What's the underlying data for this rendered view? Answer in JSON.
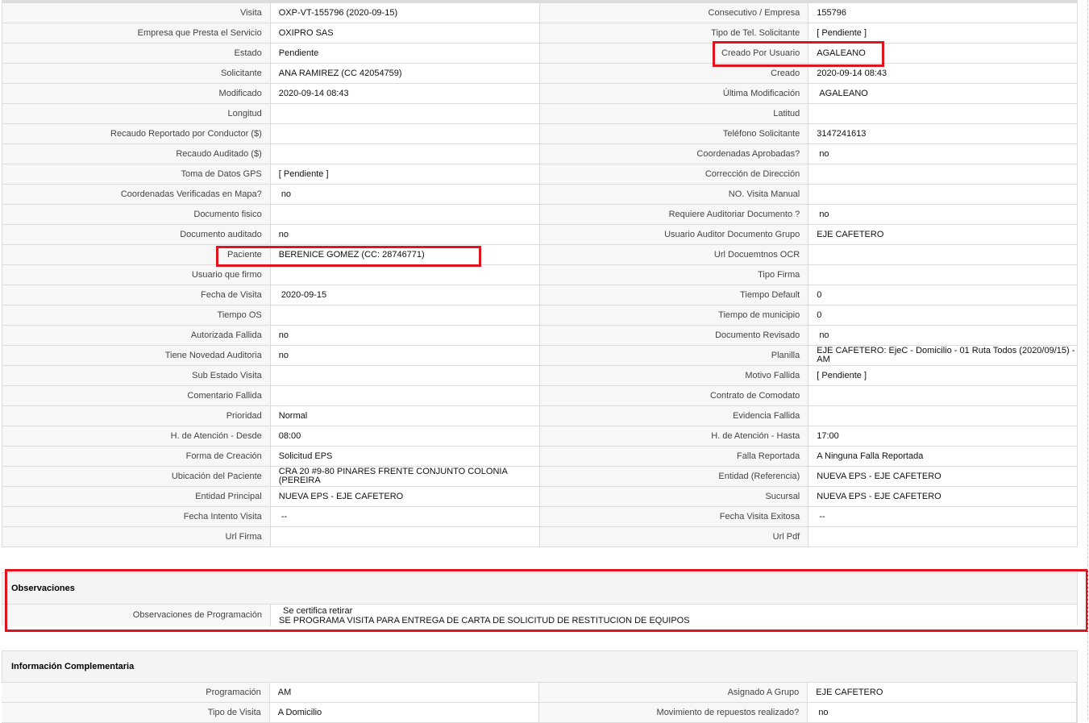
{
  "main_rows": [
    {
      "l1": "Visita",
      "v1": "OXP-VT-155796 (2020-09-15)",
      "l2": "Consecutivo / Empresa",
      "v2": "155796"
    },
    {
      "l1": "Empresa que Presta el Servicio",
      "v1": "OXIPRO SAS",
      "l2": "Tipo de Tel. Solicitante",
      "v2": "[ Pendiente ]"
    },
    {
      "l1": "Estado",
      "v1": "Pendiente",
      "l2": "Creado Por Usuario",
      "v2": "AGALEANO"
    },
    {
      "l1": "Solicitante",
      "v1": "ANA RAMIREZ (CC 42054759)",
      "l2": "Creado",
      "v2": "2020-09-14 08:43"
    },
    {
      "l1": "Modificado",
      "v1": "2020-09-14 08:43",
      "l2": "Última Modificación",
      "v2": " AGALEANO"
    },
    {
      "l1": "Longitud",
      "v1": "",
      "l2": "Latitud",
      "v2": ""
    },
    {
      "l1": "Recaudo Reportado por Conductor ($)",
      "v1": "",
      "l2": "Teléfono Solicitante",
      "v2": "3147241613"
    },
    {
      "l1": "Recaudo Auditado ($)",
      "v1": "",
      "l2": "Coordenadas Aprobadas?",
      "v2": " no"
    },
    {
      "l1": "Toma de Datos GPS",
      "v1": "[ Pendiente ]",
      "l2": "Corrección de Dirección",
      "v2": ""
    },
    {
      "l1": "Coordenadas Verificadas en Mapa?",
      "v1": " no",
      "l2": "NO. Visita Manual",
      "v2": ""
    },
    {
      "l1": "Documento fisico",
      "v1": "",
      "l2": "Requiere Auditoriar Documento ?",
      "v2": " no"
    },
    {
      "l1": "Documento auditado",
      "v1": "no",
      "l2": "Usuario Auditor Documento Grupo",
      "v2": "EJE CAFETERO"
    },
    {
      "l1": "Paciente",
      "v1": "BERENICE GOMEZ (CC: 28746771)",
      "l2": "Url Docuemtnos OCR",
      "v2": ""
    },
    {
      "l1": "Usuario que firmo",
      "v1": "",
      "l2": "Tipo Firma",
      "v2": ""
    },
    {
      "l1": "Fecha de Visita",
      "v1": " 2020-09-15",
      "l2": "Tiempo Default",
      "v2": "0"
    },
    {
      "l1": "Tiempo OS",
      "v1": "",
      "l2": "Tiempo de municipio",
      "v2": "0"
    },
    {
      "l1": "Autorizada Fallida",
      "v1": "no",
      "l2": "Documento Revisado",
      "v2": " no"
    },
    {
      "l1": "Tiene Novedad Auditoria",
      "v1": "no",
      "l2": "Planilla",
      "v2": "EJE CAFETERO: EjeC - Domicilio - 01 Ruta Todos (2020/09/15) - AM"
    },
    {
      "l1": "Sub Estado Visita",
      "v1": "",
      "l2": "Motivo Fallida",
      "v2": "[ Pendiente ]"
    },
    {
      "l1": "Comentario Fallida",
      "v1": "",
      "l2": "Contrato de Comodato",
      "v2": ""
    },
    {
      "l1": "Prioridad",
      "v1": "Normal",
      "l2": "Evidencia Fallida",
      "v2": ""
    },
    {
      "l1": "H. de Atención - Desde",
      "v1": "08:00",
      "l2": "H. de Atención - Hasta",
      "v2": "17:00"
    },
    {
      "l1": "Forma de Creación",
      "v1": "Solicitud EPS",
      "l2": "Falla Reportada",
      "v2": "A Ninguna Falla Reportada"
    },
    {
      "l1": "Ubicación del Paciente",
      "v1": "CRA 20 #9-80 PINARES FRENTE CONJUNTO COLONIA (PEREIRA",
      "l2": "Entidad (Referencia)",
      "v2": "NUEVA EPS - EJE CAFETERO"
    },
    {
      "l1": "Entidad Principal",
      "v1": "NUEVA EPS - EJE CAFETERO",
      "l2": "Sucursal",
      "v2": "NUEVA EPS - EJE CAFETERO"
    },
    {
      "l1": "Fecha Intento Visita",
      "v1": " --",
      "l2": "Fecha Visita Exitosa",
      "v2": " --"
    },
    {
      "l1": "Url Firma",
      "v1": "",
      "l2": "Url Pdf",
      "v2": ""
    }
  ],
  "observaciones": {
    "title": "Observaciones",
    "label": "Observaciones de Programación",
    "line1": " Se certifica retirar",
    "line2": "SE PROGRAMA VISITA PARA ENTREGA DE CARTA DE SOLICITUD DE RESTITUCION DE EQUIPOS"
  },
  "info_complementaria": {
    "title": "Información Complementaria",
    "rows": [
      {
        "l1": "Programación",
        "v1": "AM",
        "l2": "Asignado A Grupo",
        "v2": "EJE CAFETERO"
      },
      {
        "l1": "Tipo de Visita",
        "v1": "A Domicilio",
        "l2": "Movimiento de repuestos realizado?",
        "v2": " no"
      }
    ]
  },
  "colors": {
    "highlight": "#e0141e",
    "label_bg": "#f7f7f7",
    "border": "#dcdcdc"
  }
}
